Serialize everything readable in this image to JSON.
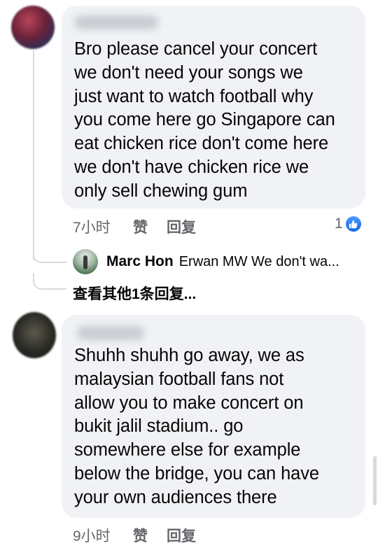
{
  "comments": [
    {
      "text": "Bro please cancel your concert\nwe don't need your songs we\njust want to watch football why\nyou come here go Singapore can\neat chicken rice don't come here\nwe don't have chicken rice we\nonly sell chewing gum",
      "time": "7小时",
      "like_label": "赞",
      "reply_label": "回复",
      "reaction_count": "1",
      "reply_preview": {
        "author": "Marc Hon",
        "snippet": "Erwan MW We don't wa..."
      },
      "more_replies_label": "查看其他1条回复..."
    },
    {
      "text": "Shuhh shuhh go away, we as\nmalaysian football fans not\nallow you to make concert on\nbukit jalil stadium.. go\nsomewhere else for example\nbelow the bridge, you can have\nyour own audiences there",
      "time": "9小时",
      "like_label": "赞",
      "reply_label": "回复"
    }
  ],
  "colors": {
    "bubble": "#f0f2f5",
    "meta_text": "#65676b",
    "like_blue": "#1877f2"
  },
  "icons": {
    "reaction": "like-thumb-icon"
  }
}
